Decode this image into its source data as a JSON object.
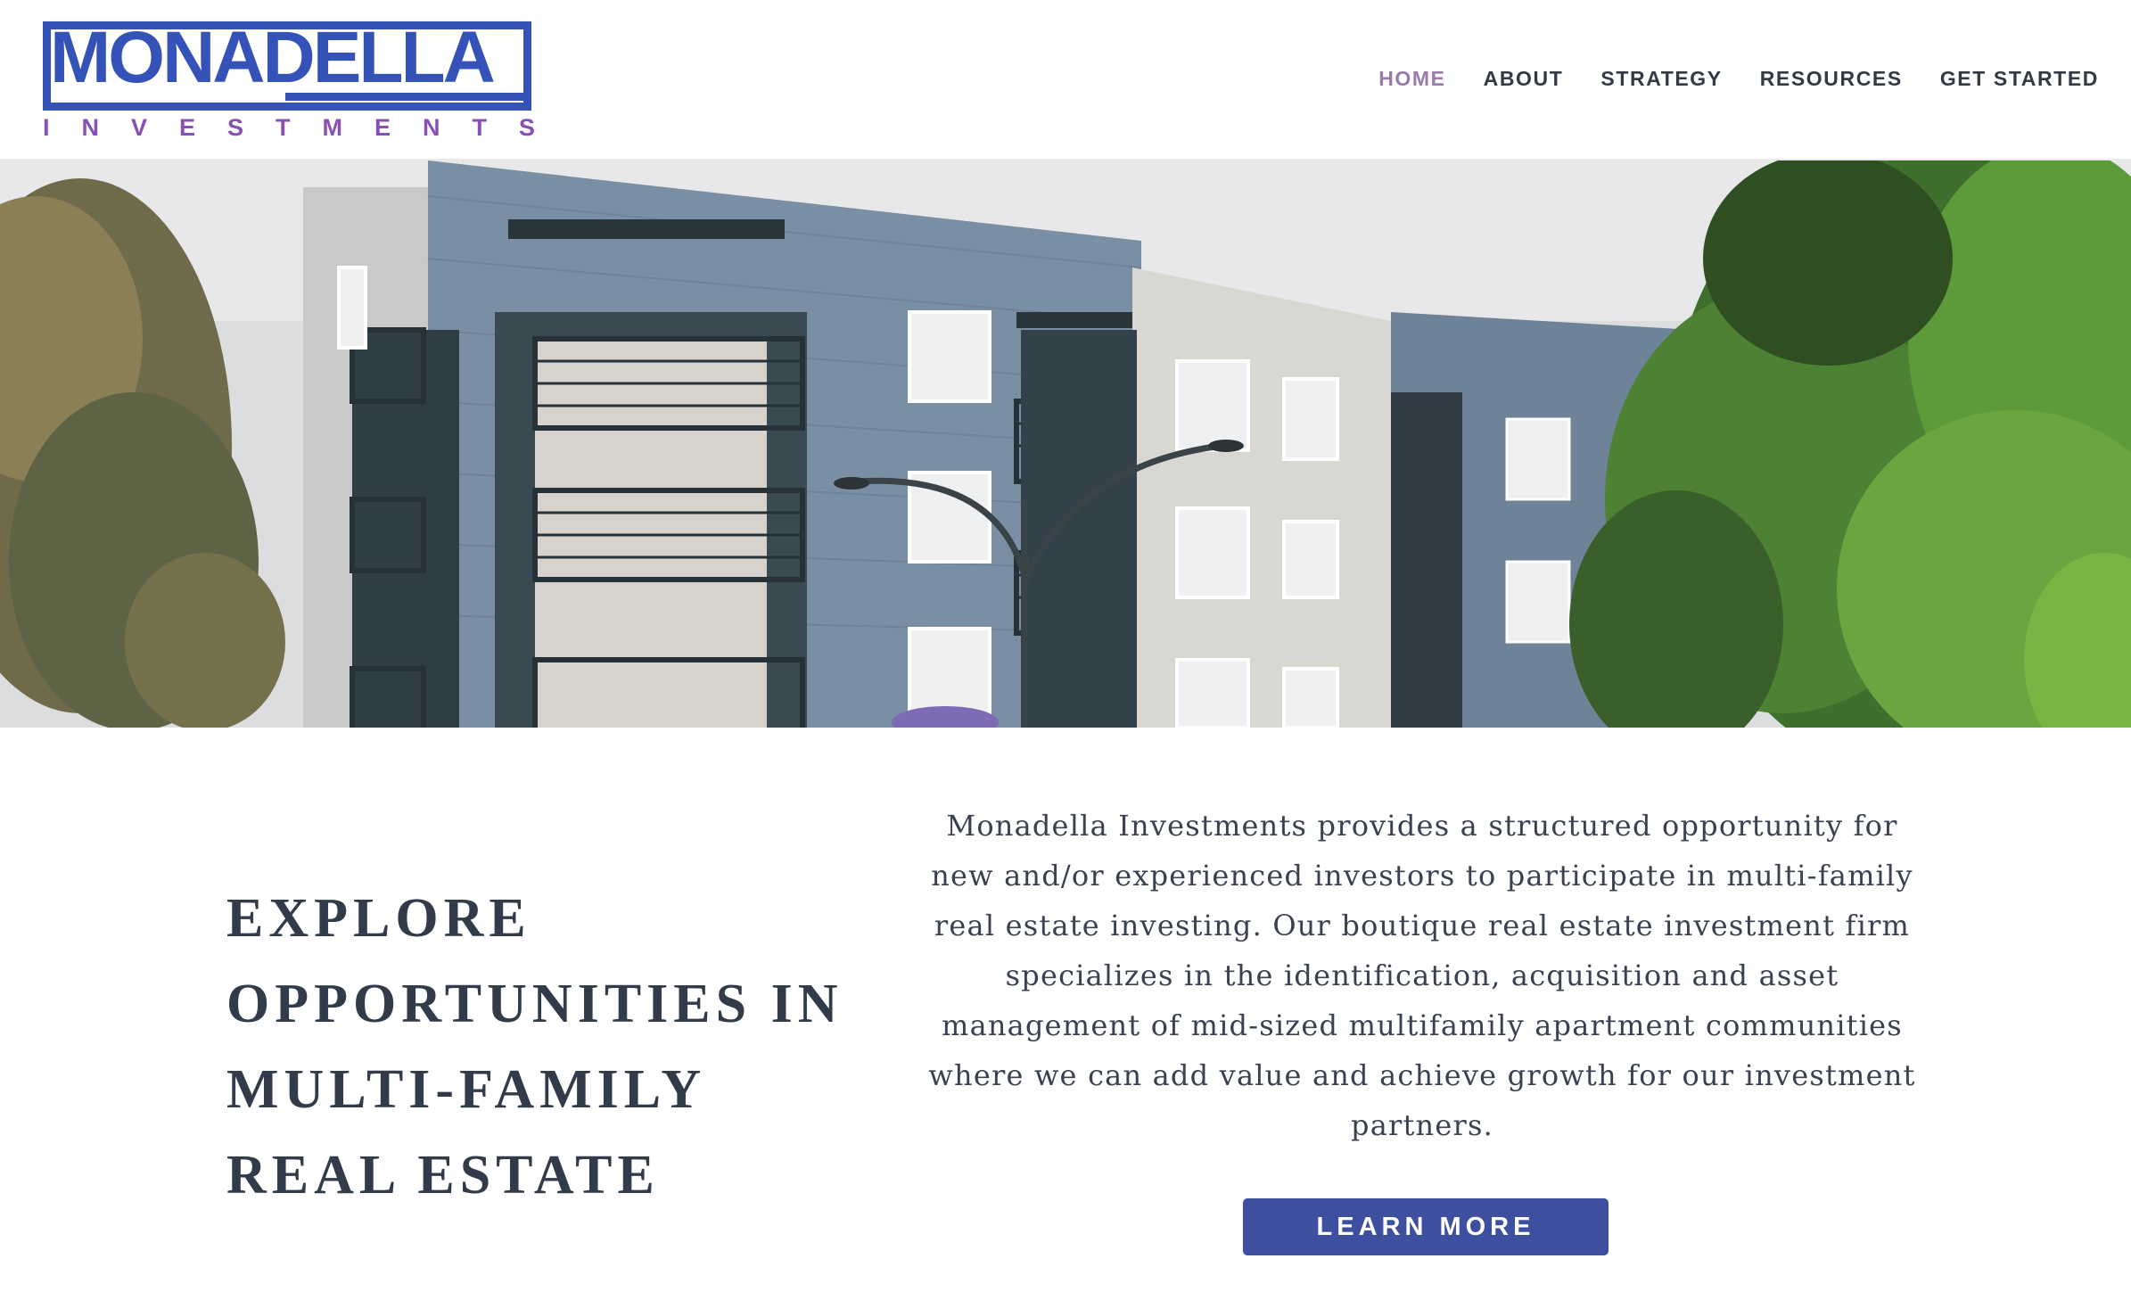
{
  "brand": {
    "name": "MONADELLA",
    "tagline_letters": [
      "I",
      "N",
      "V",
      "E",
      "S",
      "T",
      "M",
      "E",
      "N",
      "T",
      "S"
    ],
    "primary_color": "#3552b8",
    "accent_color": "#8a4fb5"
  },
  "nav": {
    "items": [
      {
        "label": "HOME",
        "active": true
      },
      {
        "label": "ABOUT",
        "active": false
      },
      {
        "label": "STRATEGY",
        "active": false
      },
      {
        "label": "RESOURCES",
        "active": false
      },
      {
        "label": "GET STARTED",
        "active": false
      }
    ],
    "active_color": "#9a7aab"
  },
  "hero": {
    "image": "apartment-building-photo"
  },
  "headline": {
    "lines": [
      "EXPLORE",
      "OPPORTUNITIES IN",
      "MULTI-FAMILY",
      "REAL ESTATE"
    ]
  },
  "description": {
    "text": "Monadella Investments provides a structured opportunity for new and/or experienced investors to participate in multi-family real estate investing. Our boutique real estate investment firm specializes in the identification, acquisition and asset management of mid-sized multifamily apartment communities where we can add value and achieve growth for our investment partners."
  },
  "cta": {
    "label": "LEARN MORE",
    "color": "#3f4fa0"
  }
}
